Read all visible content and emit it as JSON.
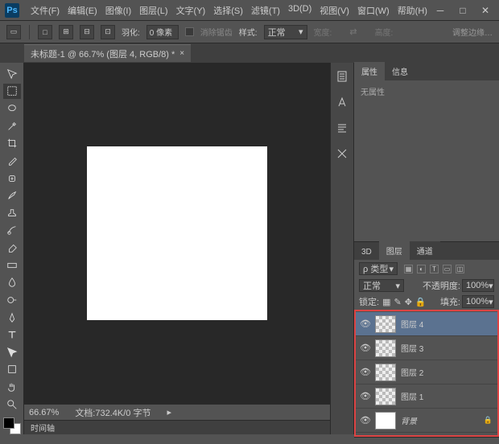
{
  "app": {
    "logo": "Ps"
  },
  "menu": [
    "文件(F)",
    "编辑(E)",
    "图像(I)",
    "图层(L)",
    "文字(Y)",
    "选择(S)",
    "滤镜(T)",
    "3D(D)",
    "视图(V)",
    "窗口(W)",
    "帮助(H)"
  ],
  "options": {
    "feather_label": "羽化:",
    "feather_value": "0 像素",
    "antialias": "消除锯齿",
    "style_label": "样式:",
    "style_value": "正常",
    "width_label": "宽度:",
    "height_label": "高度:",
    "refine": "调整边缘…"
  },
  "doc_tab": "未标题-1 @ 66.7% (图层 4, RGB/8) *",
  "status": {
    "zoom": "66.67%",
    "docinfo": "文档:732.4K/0 字节"
  },
  "bottom_tab": "时间轴",
  "panels": {
    "props_tabs": [
      "属性",
      "信息"
    ],
    "props_body": "无属性",
    "layers_tabs": [
      "3D",
      "图层",
      "通道"
    ],
    "kind_label": "ρ 类型",
    "blend": "正常",
    "opacity_label": "不透明度:",
    "opacity_val": "100%",
    "lock_label": "锁定:",
    "fill_label": "填充:",
    "fill_val": "100%",
    "layers": [
      {
        "name": "图层 4",
        "sel": true,
        "checker": true
      },
      {
        "name": "图层 3",
        "sel": false,
        "checker": true
      },
      {
        "name": "图层 2",
        "sel": false,
        "checker": true
      },
      {
        "name": "图层 1",
        "sel": false,
        "checker": true
      },
      {
        "name": "背景",
        "sel": false,
        "checker": false,
        "locked": true,
        "italic": true
      }
    ]
  }
}
